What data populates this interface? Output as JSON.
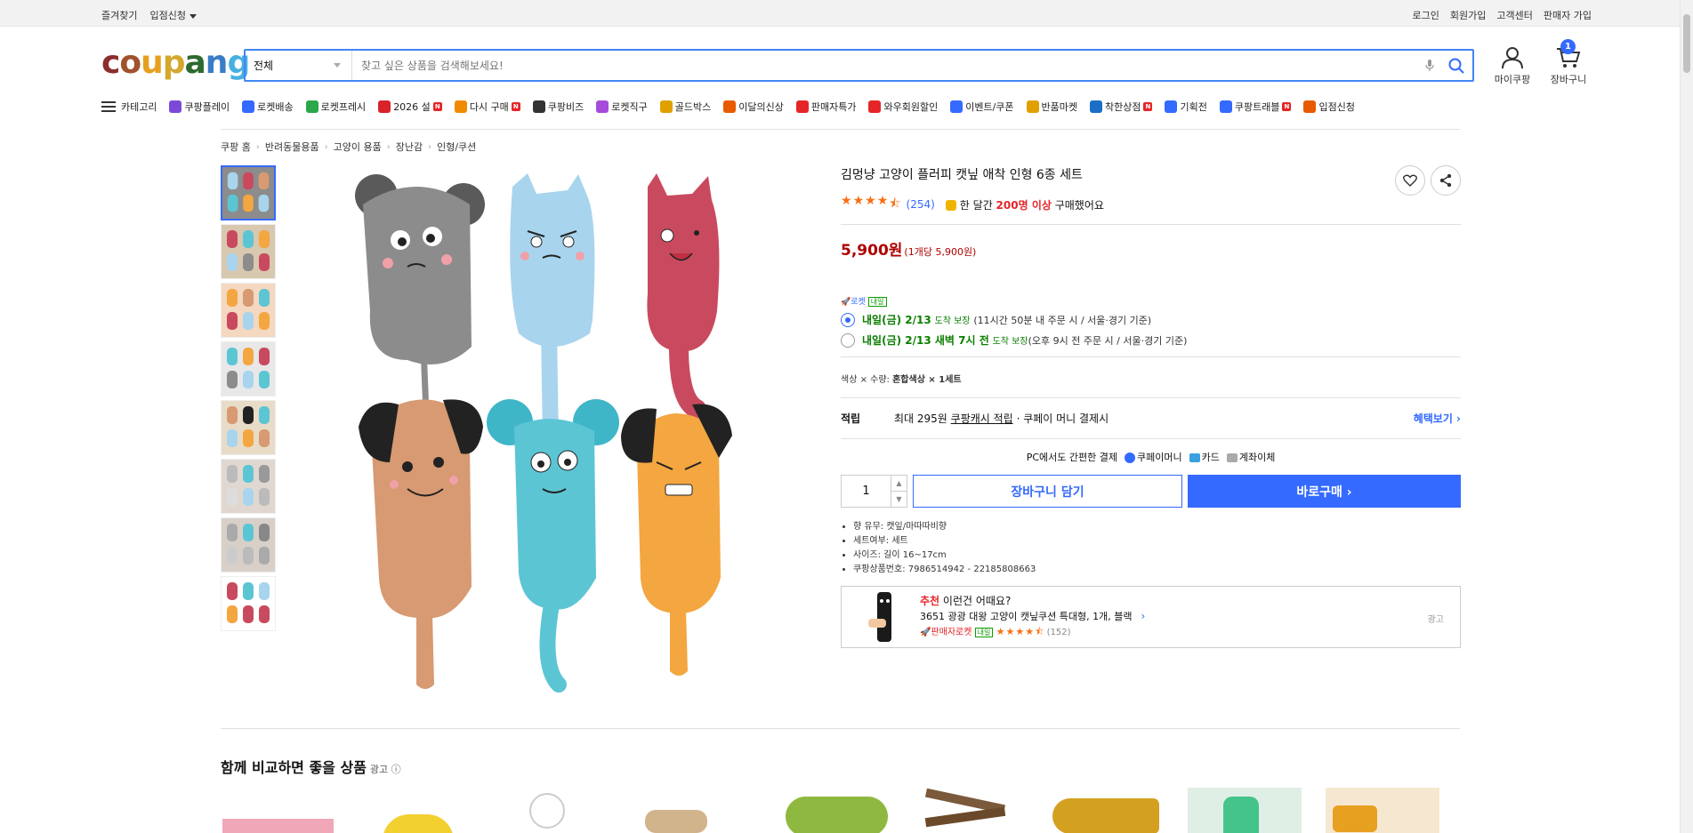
{
  "topbar": {
    "left": [
      "즐겨찾기",
      "입점신청"
    ],
    "right": [
      "로그인",
      "회원가입",
      "고객센터",
      "판매자 가입"
    ]
  },
  "header": {
    "logo": [
      "c",
      "o",
      "u",
      "p",
      "a",
      "n",
      "g"
    ],
    "logo_colors": [
      "#8b2d2d",
      "#a0522d",
      "#e6a020",
      "#d4a82f",
      "#2c6a2f",
      "#3a7dc6",
      "#46b1e0"
    ],
    "search_category": "전체",
    "search_placeholder": "찾고 싶은 상품을 검색해보세요!",
    "my_coupang": "마이쿠팡",
    "cart": "장바구니",
    "cart_count": "1"
  },
  "nav": {
    "category": "카테고리",
    "items": [
      {
        "label": "쿠팡플레이",
        "color": "#7b49d7",
        "new": false
      },
      {
        "label": "로켓배송",
        "color": "#346aff",
        "new": false
      },
      {
        "label": "로켓프레시",
        "color": "#2aa84a",
        "new": false
      },
      {
        "label": "2026 설",
        "color": "#d8232a",
        "new": true
      },
      {
        "label": "다시 구매",
        "color": "#f08a00",
        "new": true
      },
      {
        "label": "쿠팡비즈",
        "color": "#333333",
        "new": false
      },
      {
        "label": "로켓직구",
        "color": "#a64cdb",
        "new": false
      },
      {
        "label": "골드박스",
        "color": "#e0a000",
        "new": false
      },
      {
        "label": "이달의신상",
        "color": "#e85a00",
        "new": false
      },
      {
        "label": "판매자특가",
        "color": "#e52528",
        "new": false
      },
      {
        "label": "와우회원할인",
        "color": "#e52528",
        "new": false
      },
      {
        "label": "이벤트/쿠폰",
        "color": "#346aff",
        "new": false
      },
      {
        "label": "반품마켓",
        "color": "#e0a000",
        "new": false
      },
      {
        "label": "착한상점",
        "color": "#1c6ec7",
        "new": true
      },
      {
        "label": "기획전",
        "color": "#346aff",
        "new": false
      },
      {
        "label": "쿠팡트래블",
        "color": "#346aff",
        "new": true
      },
      {
        "label": "입점신청",
        "color": "#e85a00",
        "new": false
      }
    ]
  },
  "breadcrumb": [
    "쿠팡 홈",
    "반려동물용품",
    "고양이 용품",
    "장난감",
    "인형/쿠션"
  ],
  "product": {
    "title": "김멍냥 고양이 플러피 캣닢 애착 인형 6종 세트",
    "rating": 4.5,
    "review_count": "(254)",
    "sales_prefix": "한 달간 ",
    "sales_highlight": "200명 이상",
    "sales_suffix": " 구매했어요",
    "price": "5,900원",
    "unit_price": "(1개당 5,900원)",
    "rocket_label": "로켓",
    "naeil_tag": "내일",
    "delivery1_date": "내일(금) 2/13",
    "delivery1_guarantee": "도착 보장",
    "delivery1_note": "(11시간 50분 내 주문 시 / 서울·경기 기준)",
    "delivery2_date": "내일(금) 2/13 새벽 7시 전",
    "delivery2_guarantee": "도착 보장",
    "delivery2_note": "(오후 9시 전 주문 시 / 서울·경기 기준)",
    "option_prefix": "색상 × 수량: ",
    "option_value": "혼합색상 × 1세트",
    "points_label": "적립",
    "points_text": "최대 295원",
    "points_link": "쿠팡캐시 적립",
    "points_suffix": "· 쿠페이 머니 결제시",
    "points_more": "혜택보기 ›",
    "pay_label": "PC에서도 간편한 결제",
    "pay_options": [
      "쿠페이머니",
      "카드",
      "계좌이체"
    ],
    "qty": "1",
    "cart_button": "장바구니 담기",
    "buy_button": "바로구매 ›",
    "specs": [
      "향 유무: 캣잎/마따따비향",
      "세트여부: 세트",
      "사이즈: 길이 16~17cm",
      "쿠팡상품번호: 7986514942 - 22185808663"
    ]
  },
  "recommend": {
    "head_strong": "추천",
    "head_rest": " 이런건 어때요?",
    "item": "3651 광광 대왕 고양이 캣닢쿠션 특대형, 1개, 블랙",
    "seller_tag": "판매자로켓",
    "naeil_tag": "내일",
    "rating": 4.5,
    "count": "(152)",
    "ad": "광고"
  },
  "compare": {
    "title": "함께 비교하면 좋을 상품",
    "ad": "광고 ⓘ"
  }
}
